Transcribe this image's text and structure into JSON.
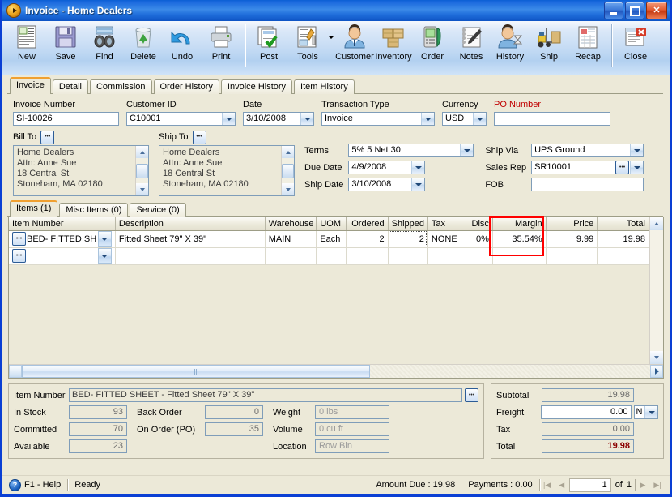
{
  "window": {
    "title_main": "Invoice",
    "title_sep": " - ",
    "title_sub": "Home Dealers",
    "app_icon": "invoice-app-icon",
    "minimize": "minimize-icon",
    "maximize": "maximize-icon",
    "close": "close-icon"
  },
  "toolbar": {
    "buttons": [
      {
        "label": "New",
        "icon": "new-document-icon"
      },
      {
        "label": "Save",
        "icon": "floppy-disk-icon"
      },
      {
        "label": "Find",
        "icon": "binoculars-icon"
      },
      {
        "label": "Delete",
        "icon": "recycle-bin-icon"
      },
      {
        "label": "Undo",
        "icon": "undo-arrow-icon"
      },
      {
        "label": "Print",
        "icon": "printer-icon"
      },
      {
        "label": "Post",
        "icon": "post-checkmark-icon"
      },
      {
        "label": "Tools",
        "icon": "tools-wrench-icon"
      },
      {
        "label": "Customer",
        "icon": "customer-person-icon"
      },
      {
        "label": "Inventory",
        "icon": "inventory-boxes-icon"
      },
      {
        "label": "Order",
        "icon": "order-phone-icon"
      },
      {
        "label": "Notes",
        "icon": "notes-pen-icon"
      },
      {
        "label": "History",
        "icon": "history-hourglass-icon"
      },
      {
        "label": "Ship",
        "icon": "forklift-ship-icon"
      },
      {
        "label": "Recap",
        "icon": "recap-report-icon"
      },
      {
        "label": "Close",
        "icon": "close-window-icon"
      }
    ],
    "dropdown_arrow": "tools-dropdown-arrow-icon"
  },
  "main_tabs": [
    {
      "label": "Invoice",
      "active": true
    },
    {
      "label": "Detail",
      "active": false
    },
    {
      "label": "Commission",
      "active": false
    },
    {
      "label": "Order History",
      "active": false
    },
    {
      "label": "Invoice History",
      "active": false
    },
    {
      "label": "Item History",
      "active": false
    }
  ],
  "header_fields": {
    "invoice_number": {
      "label": "Invoice Number",
      "value": "SI-10026"
    },
    "customer_id": {
      "label": "Customer ID",
      "value": "C10001"
    },
    "date": {
      "label": "Date",
      "value": "3/10/2008"
    },
    "transaction_type": {
      "label": "Transaction Type",
      "value": "Invoice"
    },
    "currency": {
      "label": "Currency",
      "value": "USD"
    },
    "po_number": {
      "label": "PO Number",
      "value": "",
      "label_color": "#c00000"
    }
  },
  "bill_to": {
    "label": "Bill To",
    "browse_icon": "ellipsis-browse-icon",
    "lines": [
      "Home Dealers",
      "Attn: Anne Sue",
      "18 Central St",
      "Stoneham, MA 02180"
    ]
  },
  "ship_to": {
    "label": "Ship To",
    "browse_icon": "ellipsis-browse-icon",
    "lines": [
      "Home Dealers",
      "Attn: Anne Sue",
      "18 Central St",
      "Stoneham, MA 02180"
    ]
  },
  "terms_block": {
    "terms": {
      "label": "Terms",
      "value": "5% 5 Net 30"
    },
    "due_date": {
      "label": "Due Date",
      "value": "4/9/2008"
    },
    "ship_date": {
      "label": "Ship Date",
      "value": "3/10/2008"
    },
    "ship_via": {
      "label": "Ship Via",
      "value": "UPS Ground"
    },
    "sales_rep": {
      "label": "Sales Rep",
      "value": "SR10001"
    },
    "fob": {
      "label": "FOB",
      "value": ""
    }
  },
  "grid_tabs": [
    {
      "label": "Items (1)",
      "active": true
    },
    {
      "label": "Misc Items (0)",
      "active": false
    },
    {
      "label": "Service (0)",
      "active": false
    }
  ],
  "items_grid": {
    "columns": [
      {
        "key": "item_number",
        "label": "Item Number",
        "align": "left"
      },
      {
        "key": "description",
        "label": "Description",
        "align": "left"
      },
      {
        "key": "warehouse",
        "label": "Warehouse",
        "align": "left"
      },
      {
        "key": "uom",
        "label": "UOM",
        "align": "left"
      },
      {
        "key": "ordered",
        "label": "Ordered",
        "align": "right"
      },
      {
        "key": "shipped",
        "label": "Shipped",
        "align": "right"
      },
      {
        "key": "tax",
        "label": "Tax",
        "align": "left"
      },
      {
        "key": "disc",
        "label": "Disc",
        "align": "right"
      },
      {
        "key": "margin",
        "label": "Margin",
        "align": "right"
      },
      {
        "key": "price",
        "label": "Price",
        "align": "right"
      },
      {
        "key": "total",
        "label": "Total",
        "align": "right"
      }
    ],
    "rows": [
      {
        "item_number": "BED- FITTED SHEE",
        "description": "Fitted Sheet 79\" X 39\"",
        "warehouse": "MAIN",
        "uom": "Each",
        "ordered": "2",
        "shipped": "2",
        "tax": "NONE",
        "disc": "0%",
        "margin": "35.54%",
        "price": "9.99",
        "total": "19.98"
      },
      {
        "item_number": "",
        "description": "",
        "warehouse": "",
        "uom": "",
        "ordered": "",
        "shipped": "",
        "tax": "",
        "disc": "",
        "margin": "",
        "price": "",
        "total": ""
      }
    ],
    "highlight": {
      "column": "Margin",
      "color": "#ff0000"
    },
    "scroll_left_icon": "scroll-left-icon",
    "scroll_right_icon": "scroll-right-icon",
    "scroll_up_icon": "scroll-up-icon",
    "scroll_down_icon": "scroll-down-icon"
  },
  "item_detail": {
    "item_number": {
      "label": "Item Number",
      "value": "BED- FITTED SHEET - Fitted Sheet 79\" X 39\"",
      "browse_icon": "ellipsis-browse-icon"
    },
    "in_stock": {
      "label": "In Stock",
      "value": "93"
    },
    "committed": {
      "label": "Committed",
      "value": "70"
    },
    "available": {
      "label": "Available",
      "value": "23"
    },
    "back_order": {
      "label": "Back Order",
      "value": "0"
    },
    "on_order_po": {
      "label": "On Order (PO)",
      "value": "35"
    },
    "weight": {
      "label": "Weight",
      "value": "0 lbs"
    },
    "volume": {
      "label": "Volume",
      "value": "0 cu ft"
    },
    "location": {
      "label": "Location",
      "value": "Row  Bin"
    }
  },
  "totals": {
    "subtotal": {
      "label": "Subtotal",
      "value": "19.98"
    },
    "freight": {
      "label": "Freight",
      "value": "0.00",
      "taxable": "N"
    },
    "tax": {
      "label": "Tax",
      "value": "0.00"
    },
    "total": {
      "label": "Total",
      "value": "19.98",
      "color": "#8b0000"
    }
  },
  "status_bar": {
    "help": "F1 - Help",
    "help_icon": "help-question-icon",
    "state": "Ready",
    "amount_due": "Amount Due : 19.98",
    "payments": "Payments : 0.00",
    "nav": {
      "first_icon": "nav-first-icon",
      "prev_icon": "nav-prev-icon",
      "page": "1",
      "of_label": "of",
      "page_count": "1",
      "next_icon": "nav-next-icon",
      "last_icon": "nav-last-icon"
    }
  }
}
